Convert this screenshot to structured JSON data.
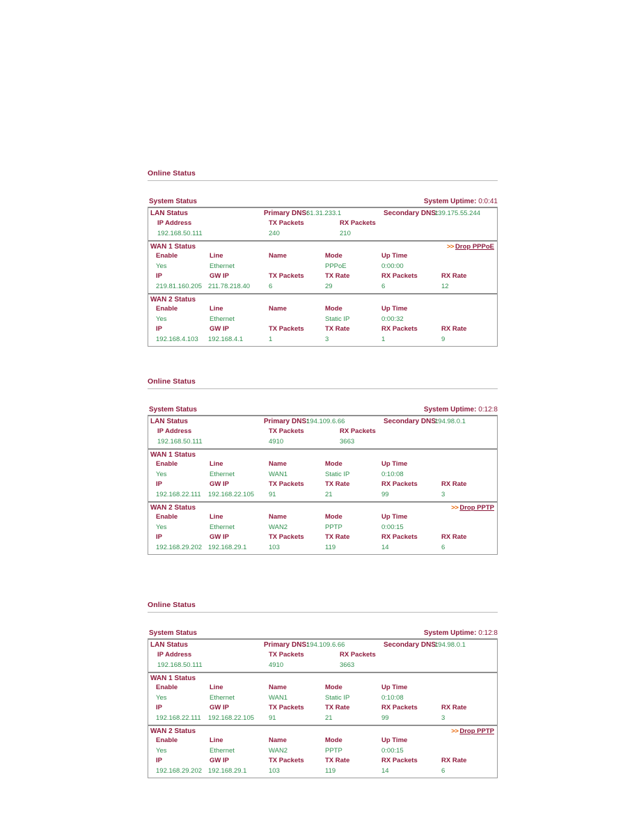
{
  "page": {
    "title": "Online Status",
    "colors": {
      "label": "#8c1a3c",
      "value": "#2f8f4e",
      "link": "#8c1a3c",
      "arrow": "#e8670a",
      "border": "#8f8f8f"
    }
  },
  "labels": {
    "online_status": "Online Status",
    "system_status": "System Status",
    "system_uptime": "System Uptime:",
    "lan_status": "LAN Status",
    "primary_dns": "Primary DNS:",
    "secondary_dns": "Secondary DNS:",
    "ip_address": "IP Address",
    "tx_packets": "TX Packets",
    "rx_packets": "RX Packets",
    "wan1_status": "WAN 1 Status",
    "wan2_status": "WAN 2 Status",
    "enable": "Enable",
    "line": "Line",
    "name": "Name",
    "mode": "Mode",
    "up_time": "Up Time",
    "ip": "IP",
    "gw_ip": "GW IP",
    "tx_rate": "TX Rate",
    "rx_rate": "RX Rate",
    "arrows": ">>"
  },
  "panels": [
    {
      "id": "panel-1",
      "title": "Online Status",
      "system_uptime": "0:0:41",
      "lan": {
        "primary_dns": "61.31.233.1",
        "secondary_dns": "139.175.55.244",
        "ip_address": "192.168.50.111",
        "tx_packets": "240",
        "rx_packets": "210"
      },
      "wan1": {
        "drop_link": "Drop PPPoE",
        "has_drop_link": true,
        "enable": "Yes",
        "line": "Ethernet",
        "name": "",
        "mode": "PPPoE",
        "up_time": "0:00:00",
        "ip": "219.81.160.205",
        "gw_ip": "211.78.218.40",
        "tx_packets": "6",
        "tx_rate": "29",
        "rx_packets": "6",
        "rx_rate": "12"
      },
      "wan2": {
        "drop_link": "",
        "has_drop_link": false,
        "enable": "Yes",
        "line": "Ethernet",
        "name": "",
        "mode": "Static IP",
        "up_time": "0:00:32",
        "ip": "192.168.4.103",
        "gw_ip": "192.168.4.1",
        "tx_packets": "1",
        "tx_rate": "3",
        "rx_packets": "1",
        "rx_rate": "9"
      }
    },
    {
      "id": "panel-2",
      "title": "Online Status",
      "system_uptime": "0:12:8",
      "lan": {
        "primary_dns": "194.109.6.66",
        "secondary_dns": "194.98.0.1",
        "ip_address": "192.168.50.111",
        "tx_packets": "4910",
        "rx_packets": "3663"
      },
      "wan1": {
        "drop_link": "",
        "has_drop_link": false,
        "enable": "Yes",
        "line": "Ethernet",
        "name": "WAN1",
        "mode": "Static IP",
        "up_time": "0:10:08",
        "ip": "192.168.22.111",
        "gw_ip": "192.168.22.105",
        "tx_packets": "91",
        "tx_rate": "21",
        "rx_packets": "99",
        "rx_rate": "3"
      },
      "wan2": {
        "drop_link": "Drop PPTP",
        "has_drop_link": true,
        "enable": "Yes",
        "line": "Ethernet",
        "name": "WAN2",
        "mode": "PPTP",
        "up_time": "0:00:15",
        "ip": "192.168.29.202",
        "gw_ip": "192.168.29.1",
        "tx_packets": "103",
        "tx_rate": "119",
        "rx_packets": "14",
        "rx_rate": "6"
      }
    },
    {
      "id": "panel-3",
      "title": "Online Status",
      "system_uptime": "0:12:8",
      "lan": {
        "primary_dns": "194.109.6.66",
        "secondary_dns": "194.98.0.1",
        "ip_address": "192.168.50.111",
        "tx_packets": "4910",
        "rx_packets": "3663"
      },
      "wan1": {
        "drop_link": "",
        "has_drop_link": false,
        "enable": "Yes",
        "line": "Ethernet",
        "name": "WAN1",
        "mode": "Static IP",
        "up_time": "0:10:08",
        "ip": "192.168.22.111",
        "gw_ip": "192.168.22.105",
        "tx_packets": "91",
        "tx_rate": "21",
        "rx_packets": "99",
        "rx_rate": "3"
      },
      "wan2": {
        "drop_link": "Drop PPTP",
        "has_drop_link": true,
        "enable": "Yes",
        "line": "Ethernet",
        "name": "WAN2",
        "mode": "PPTP",
        "up_time": "0:00:15",
        "ip": "192.168.29.202",
        "gw_ip": "192.168.29.1",
        "tx_packets": "103",
        "tx_rate": "119",
        "rx_packets": "14",
        "rx_rate": "6"
      }
    }
  ],
  "layout": {
    "panel_tops": [
      243,
      542,
      863
    ]
  }
}
